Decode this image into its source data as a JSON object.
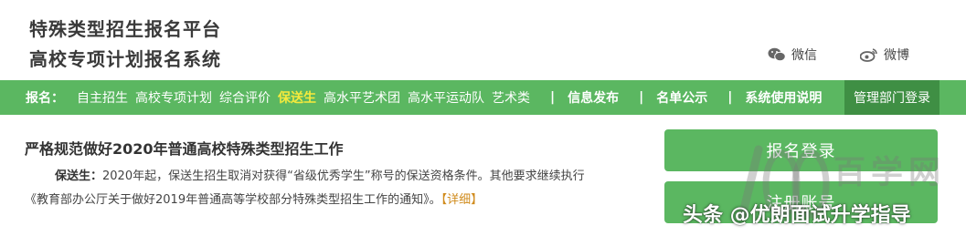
{
  "header": {
    "title_line1": "特殊类型招生报名平台",
    "title_line2": "高校专项计划报名系统",
    "wechat_label": "微信",
    "weibo_label": "微博"
  },
  "nav": {
    "label": "报名：",
    "items": [
      "自主招生",
      "高校专项计划",
      "综合评价",
      "保送生",
      "高水平艺术团",
      "高水平运动队",
      "艺术类"
    ],
    "active_item": "保送生",
    "separator": "|",
    "news": "信息发布",
    "list": "名单公示",
    "guide": "系统使用说明",
    "admin": "管理部门登录"
  },
  "article": {
    "title": "严格规范做好2020年普通高校特殊类型招生工作",
    "lead_label": "保送生：",
    "text_line1": "2020年起，保送生招生取消对获得“省级优秀学生”称号的保送资格条件。其他要求继续执行",
    "text_line2": "《教育部办公厅关于做好2019年普通高等学校部分特殊类型招生工作的通知》。",
    "more": "【详细】"
  },
  "buttons": {
    "login": "报名登录",
    "register": "注册账号"
  },
  "watermark": {
    "site": "百学网",
    "byline": "头条 @优朗面试升学指导"
  },
  "colors": {
    "nav_green": "#5bb761",
    "admin_green": "#3f8f44",
    "active_yellow": "#f5ea3c",
    "link_orange": "#d08b1c"
  }
}
